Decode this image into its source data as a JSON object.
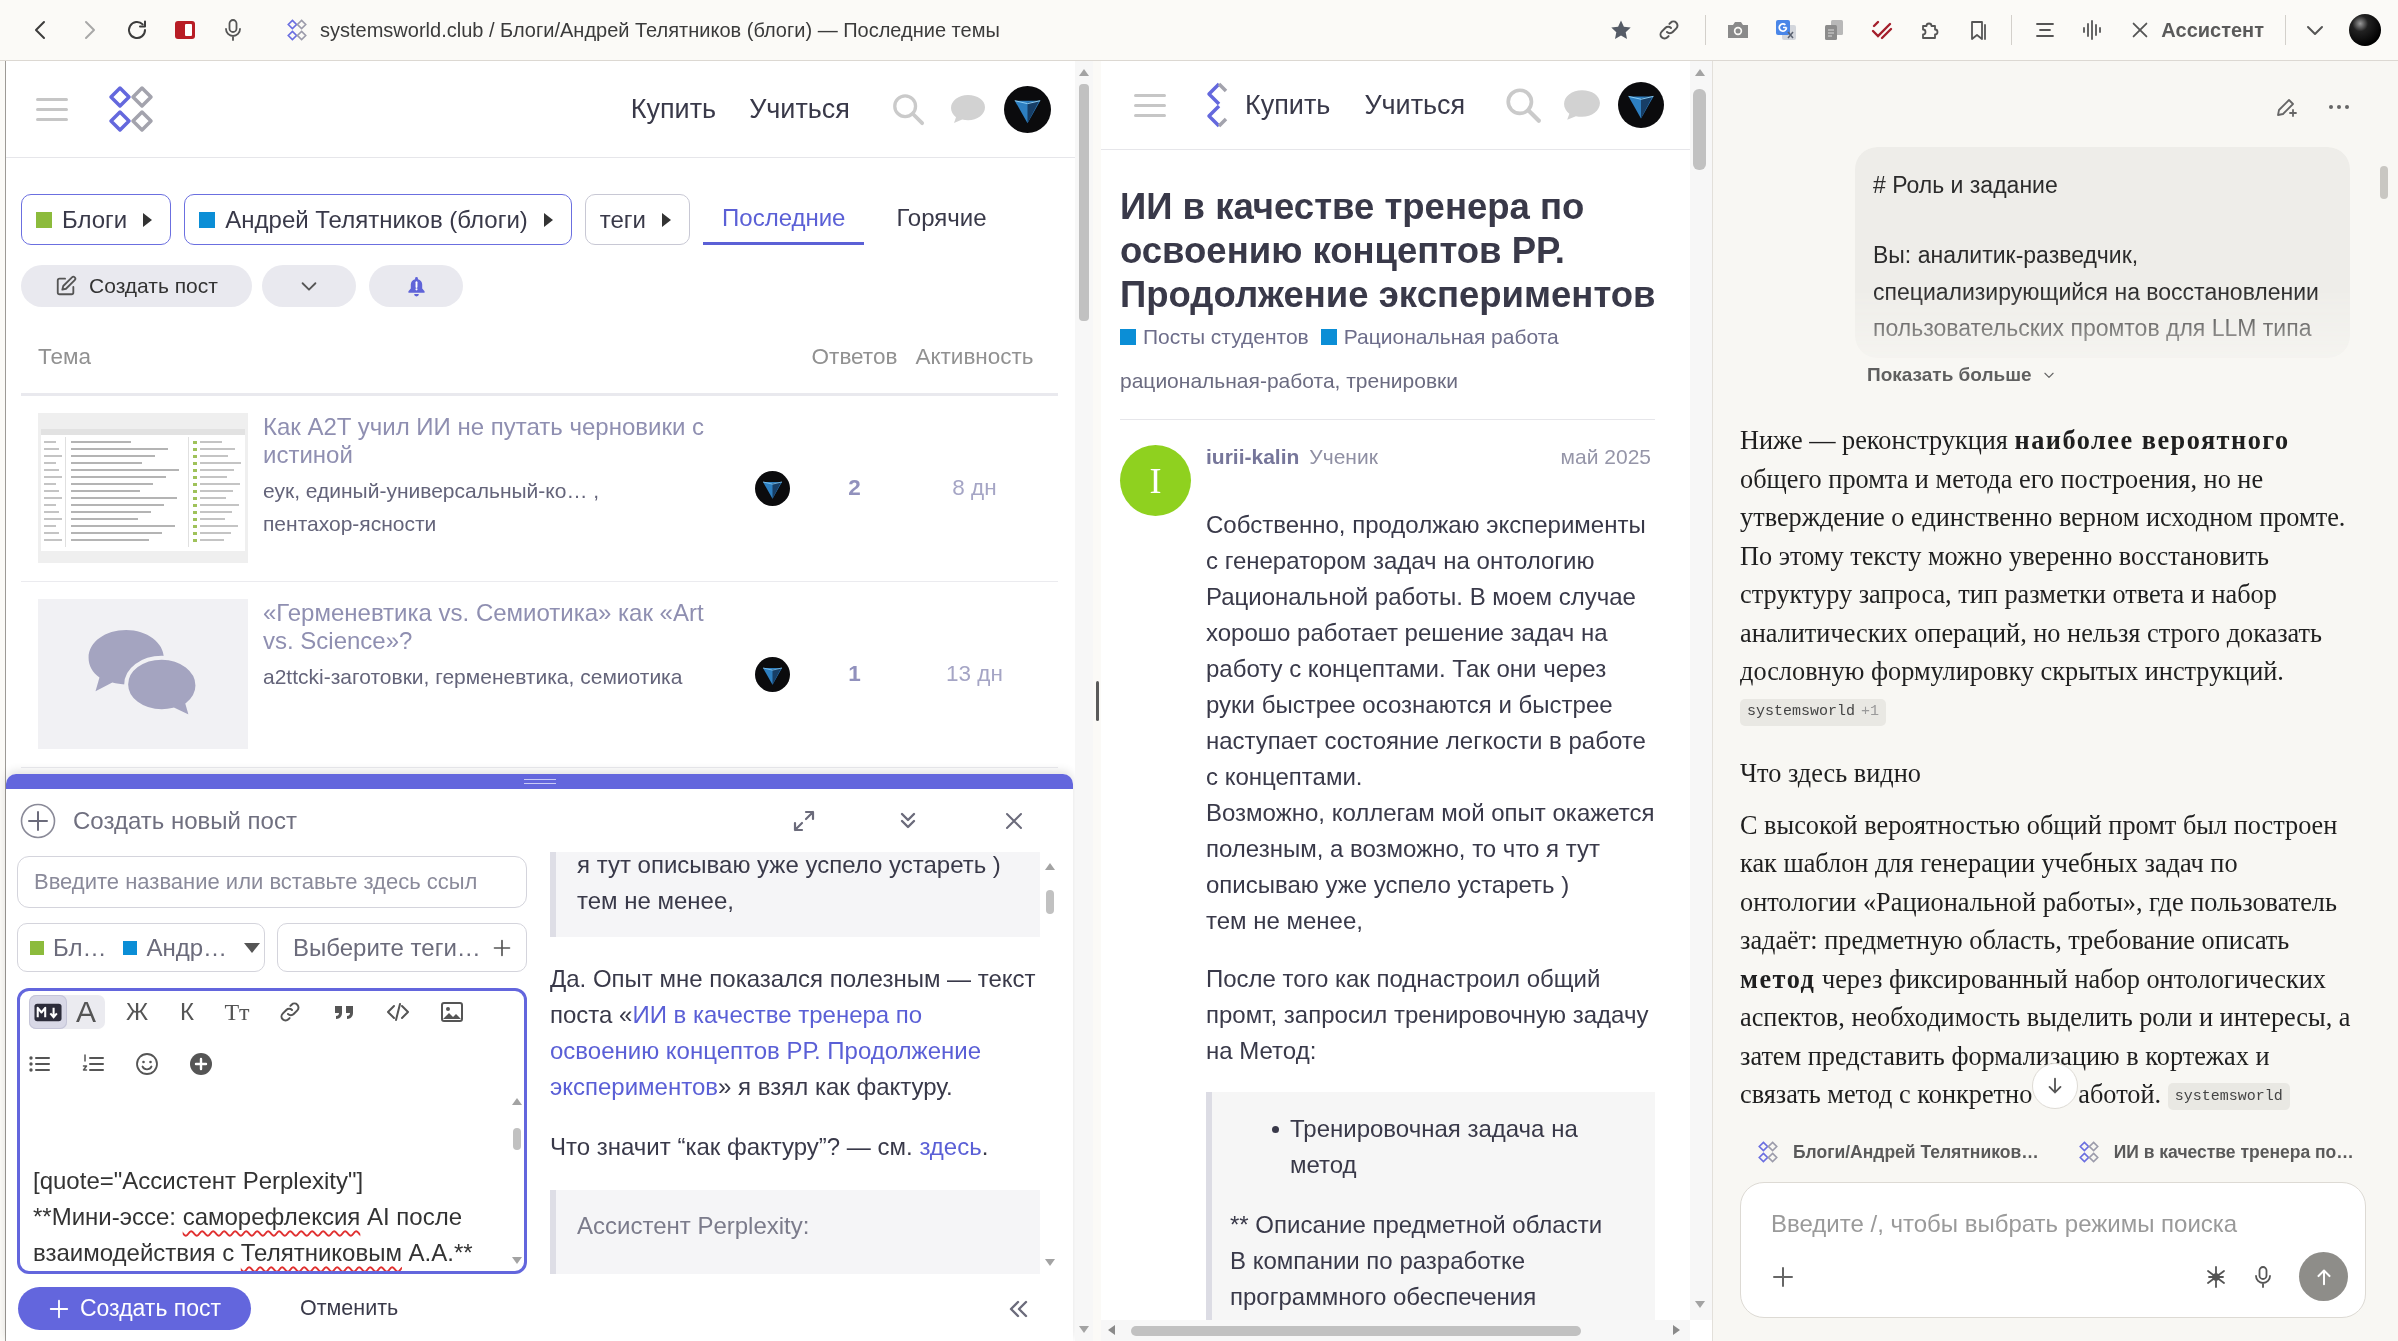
{
  "browser": {
    "address": "systemsworld.club / Блоги/Андрей Телятников (блоги) — Последние темы",
    "assistant_label": "Ассистент"
  },
  "forum": {
    "nav_links": [
      "Купить",
      "Учиться"
    ],
    "filters": [
      {
        "kind": "category",
        "label": "Блоги",
        "color": "#8cbb3c"
      },
      {
        "kind": "category",
        "label": "Андрей Телятников (блоги)",
        "color": "#0b8ed6"
      },
      {
        "kind": "tag",
        "label": "теги"
      }
    ],
    "tabs": [
      {
        "label": "Последние",
        "selected": true
      },
      {
        "label": "Горячие",
        "selected": false
      }
    ],
    "create_button": "Создать пост",
    "columns": [
      "Тема",
      "Ответов",
      "Активность"
    ],
    "topics": [
      {
        "kind": "screenshot",
        "title": "Как A2T учил ИИ не путать черновики с истиной",
        "tags": "еук, единый-универсальный-ко… , пентахор-ясности",
        "replies": "2",
        "activity": "8 дн"
      },
      {
        "kind": "placeholder",
        "title": "«Герменевтика vs. Семиотика» как «Art vs. Science»?",
        "tags": "a2ttcki-заготовки, герменевтика, семиотика",
        "replies": "1",
        "activity": "13 дн"
      }
    ]
  },
  "composer": {
    "title": "Создать новый пост",
    "title_placeholder": "Введите название или вставьте здесь ссыл",
    "categories": [
      {
        "label": "Бл…",
        "color": "#8cbb3c"
      },
      {
        "label": "Андр…",
        "color": "#0b8ed6"
      }
    ],
    "tags_placeholder": "Выберите теги…",
    "editor": {
      "modes": [
        {
          "kind": "markdown",
          "selected": true
        },
        {
          "kind": "rich",
          "label": "A",
          "selected": false
        }
      ],
      "format_buttons": [
        "Ж",
        "К",
        "Tт"
      ],
      "lines": [
        {
          "segments": [
            {
              "text": "[quote=\"Ассистент Perplexity\"]",
              "misspelled": false
            }
          ]
        },
        {
          "segments": [
            {
              "text": "**Мини-эссе: ",
              "misspelled": false
            },
            {
              "text": "саморефлексия",
              "misspelled": true
            },
            {
              "text": " AI после взаимодействия с ",
              "misspelled": false
            },
            {
              "text": "Телятниковым",
              "misspelled": true
            },
            {
              "text": " А.А.**",
              "misspelled": false
            }
          ]
        }
      ]
    },
    "preview": [
      {
        "kind": "quote",
        "text": "я тут описываю уже успело устареть )\nтем не менее,"
      },
      {
        "kind": "paragraph",
        "segments": [
          {
            "kind": "text",
            "text": "Да. Опыт мне показался полезным — текст поста «"
          },
          {
            "kind": "link",
            "lines": [
              "ИИ в качестве тренера по",
              "освоению концептов РР. Продолжение",
              "экспериментов"
            ]
          },
          {
            "kind": "text",
            "text": "» я взял как фактуру."
          }
        ]
      },
      {
        "kind": "paragraph",
        "segments": [
          {
            "kind": "text",
            "text": "Что значит “как фактуру”? — см. "
          },
          {
            "kind": "link",
            "lines": [
              "здесь"
            ]
          },
          {
            "kind": "text",
            "text": "."
          }
        ]
      },
      {
        "kind": "quote_header",
        "text": "Ассистент Perplexity:"
      }
    ],
    "submit": "Создать пост",
    "cancel": "Отменить"
  },
  "topic": {
    "nav_links": [
      "Купить",
      "Учиться"
    ],
    "title": "ИИ в качестве тренера по освоению концептов РР. Продолжение экспериментов",
    "categories": [
      {
        "label": "Посты студентов",
        "color": "#0b8ed6"
      },
      {
        "label": "Рациональная работа",
        "color": "#0b8ed6"
      }
    ],
    "tags": "рациональная-работа, тренировки",
    "post": {
      "avatar_letter": "I",
      "author": "iurii-kalin",
      "user_title": "Ученик",
      "date": "май 2025",
      "blocks": [
        {
          "kind": "paragraph",
          "text": "Собственно, продолжаю эксперименты с генератором задач на онтологию Рациональной работы. В моем случае хорошо работает решение задач на работу с концептами. Так они через руки быстрее осознаются и быстрее наступает состояние легкости в работе с концептами.\nВозможно, коллегам мой опыт окажется полезным, а возможно, то что я тут описываю уже успело устареть )\nтем не менее,"
        },
        {
          "kind": "paragraph",
          "text": "После того как поднастроил общий промт, запросил тренировочную задачу на Метод:"
        },
        {
          "kind": "quote",
          "items": [
            "Тренировочная задача на метод"
          ],
          "text": "** Описание предметной области\nВ компании по разработке программного обеспечения"
        }
      ]
    }
  },
  "assistant": {
    "prompt": [
      "# Роль и задание",
      "Вы: аналитик-разведчик, специализирующийся на восстановлении пользовательских промтов для LLM типа"
    ],
    "show_more": "Показать больше",
    "answer": [
      {
        "kind": "paragraph",
        "text": "Ниже — реконструкция **наиболее вероятного** общего промта и метода его построения, но не утверждение о единственно верном исходном промте. По этому тексту можно уверенно восстановить структуру запроса, тип разметки ответа и набор аналитических операций, но нельзя строго доказать дословную формулировку скрытых инструкций.",
        "citation": {
          "label": "systemsworld",
          "extra": "+1"
        }
      },
      {
        "kind": "heading",
        "text": "Что здесь видно"
      },
      {
        "kind": "paragraph",
        "text": "С высокой вероятностью общий промт был построен как шаблон для генерации учебных задач по онтологии «Рациональной работы», где пользователь задаёт: предметную область, требование описать **метод** через фиксированный набор онтологических аспектов, необходимость выделить роли и интересы, а затем представить формализацию в кортежах и связать метод с конкретно",
        "text_after_scroll_button": "аботой.",
        "citation": {
          "label": "systemsworld"
        }
      }
    ],
    "sources": [
      "Блоги/Андрей Телятников…",
      "ИИ в качестве тренера по…"
    ],
    "input_placeholder": "Введите /, чтобы выбрать режимы поиска"
  }
}
